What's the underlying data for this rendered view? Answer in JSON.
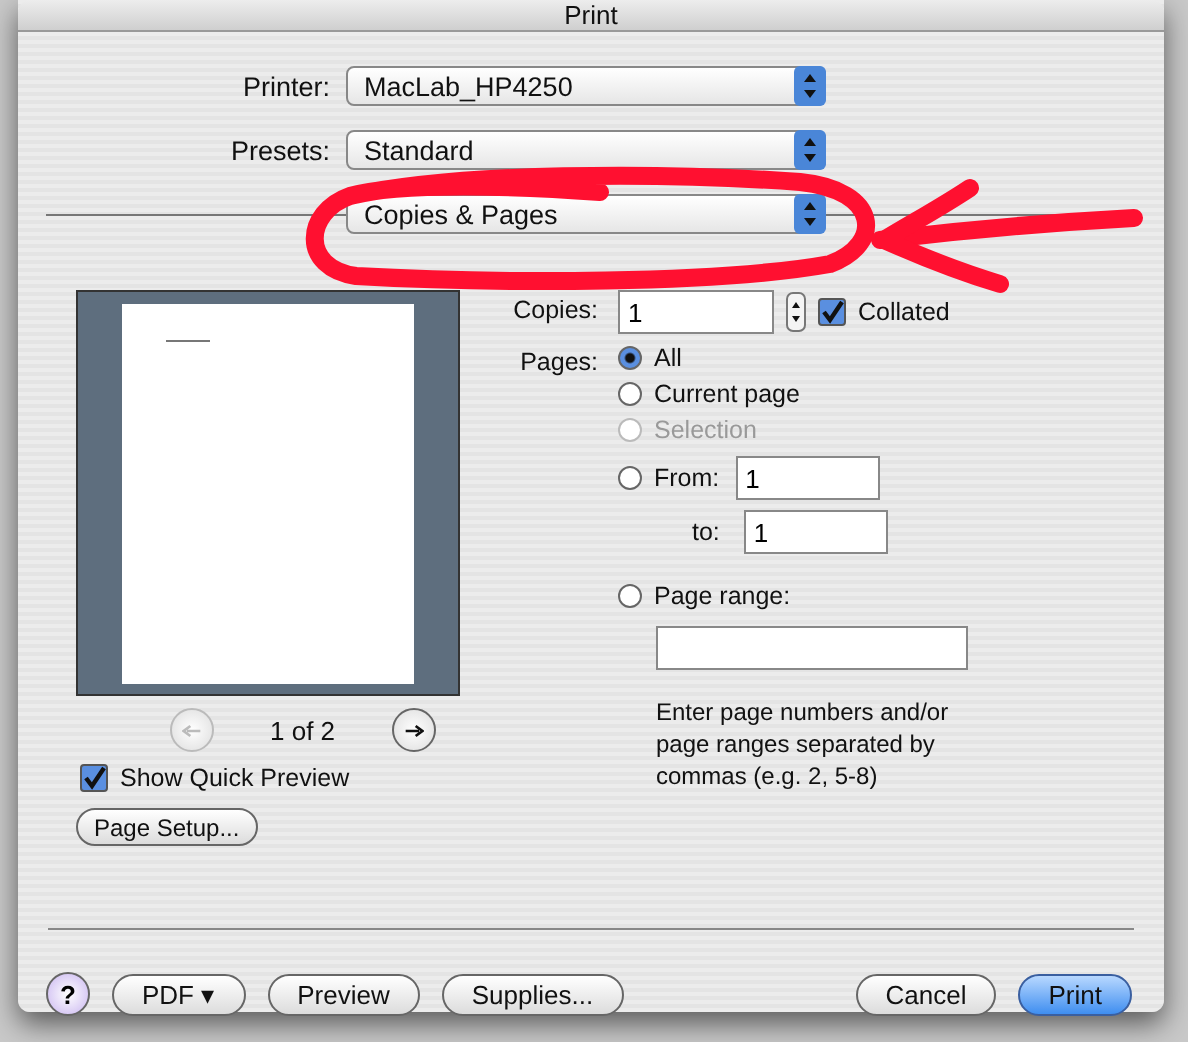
{
  "window": {
    "title": "Print"
  },
  "popups": [
    {
      "label": "Printer:",
      "value": "MacLab_HP4250"
    },
    {
      "label": "Presets:",
      "value": "Standard"
    }
  ],
  "section_popup": {
    "value": "Copies & Pages"
  },
  "preview": {
    "page_indicator": "1 of 2",
    "previous_disabled": true,
    "next_disabled": false,
    "show_quick_preview": {
      "label": "Show Quick Preview",
      "checked": true
    },
    "page_setup_button": "Page Setup..."
  },
  "copies": {
    "label": "Copies:",
    "value": "1",
    "collated": {
      "label": "Collated",
      "checked": true
    }
  },
  "pages": {
    "label": "Pages:",
    "options": [
      {
        "kind": "plain",
        "label": "All",
        "selected": true,
        "disabled": false
      },
      {
        "kind": "plain",
        "label": "Current page",
        "selected": false,
        "disabled": false
      },
      {
        "kind": "plain",
        "label": "Selection",
        "selected": false,
        "disabled": true
      },
      {
        "kind": "from_to",
        "label": "From:",
        "selected": false,
        "disabled": false,
        "from": "1",
        "to_label": "to:",
        "to": "1"
      },
      {
        "kind": "range",
        "label": "Page range:",
        "selected": false,
        "disabled": false
      }
    ],
    "hint": "Enter page numbers and/or page ranges separated by commas (e.g. 2, 5-8)"
  },
  "buttons": [
    {
      "kind": "help",
      "label": "?"
    },
    {
      "kind": "menu",
      "label": "PDF ▾"
    },
    {
      "kind": "plain",
      "label": "Preview"
    },
    {
      "kind": "plain",
      "label": "Supplies..."
    },
    {
      "kind": "spacer"
    },
    {
      "kind": "plain",
      "label": "Cancel"
    },
    {
      "kind": "default",
      "label": "Print"
    }
  ]
}
